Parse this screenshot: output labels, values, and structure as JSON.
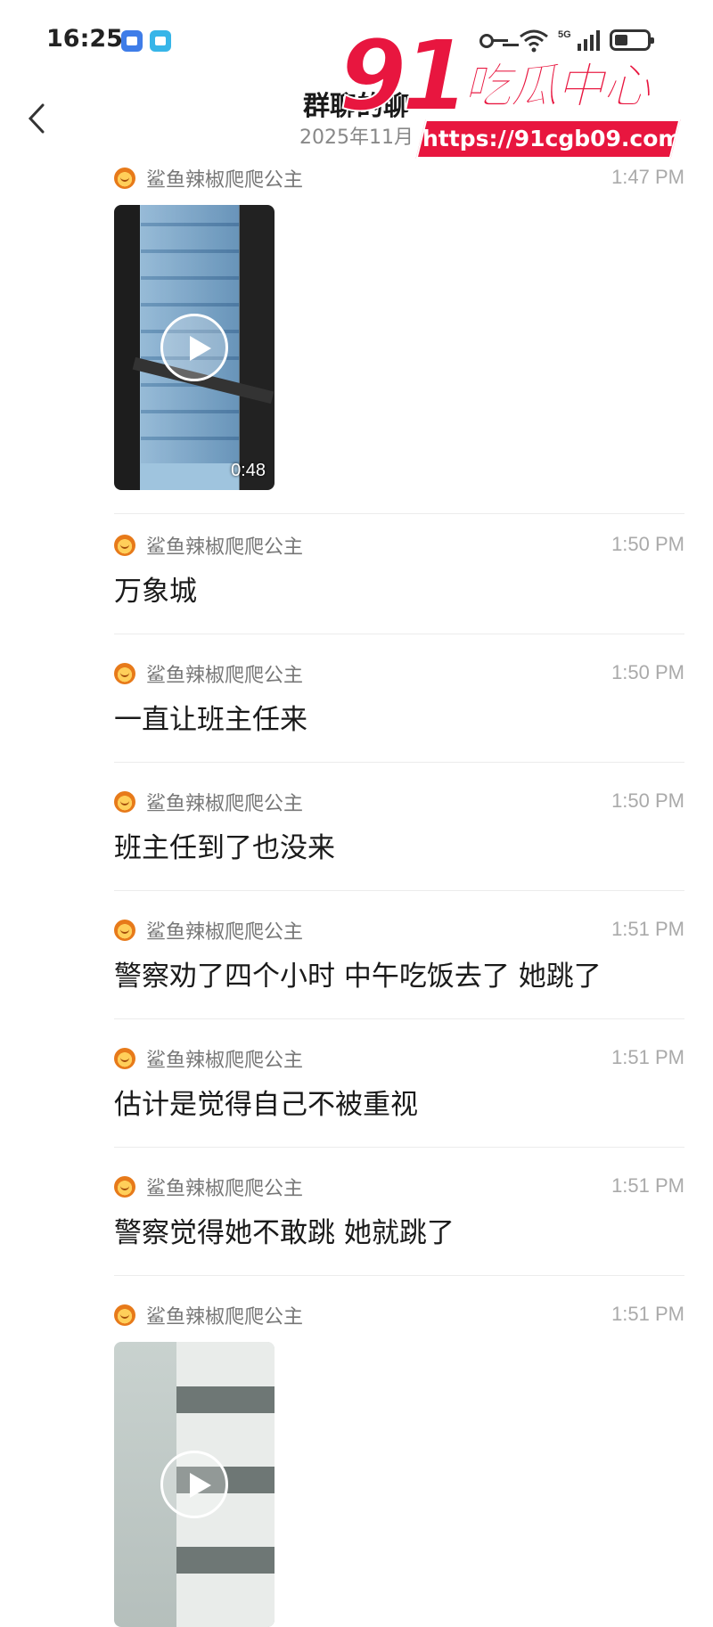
{
  "status_bar": {
    "time": "16:25"
  },
  "header": {
    "title": "群聊的聊",
    "subtitle": "2025年11月"
  },
  "watermark": {
    "number": "91",
    "text": "吃瓜中心",
    "url": "https://91cgb09.com"
  },
  "messages": [
    {
      "sender": "鲨鱼辣椒爬爬公主",
      "time": "1:47 PM",
      "type": "video",
      "duration": "0:48"
    },
    {
      "sender": "鲨鱼辣椒爬爬公主",
      "time": "1:50 PM",
      "type": "text",
      "text": "万象城"
    },
    {
      "sender": "鲨鱼辣椒爬爬公主",
      "time": "1:50 PM",
      "type": "text",
      "text": "一直让班主任来"
    },
    {
      "sender": "鲨鱼辣椒爬爬公主",
      "time": "1:50 PM",
      "type": "text",
      "text": "班主任到了也没来"
    },
    {
      "sender": "鲨鱼辣椒爬爬公主",
      "time": "1:51 PM",
      "type": "text",
      "text": "警察劝了四个小时 中午吃饭去了 她跳了"
    },
    {
      "sender": "鲨鱼辣椒爬爬公主",
      "time": "1:51 PM",
      "type": "text",
      "text": "估计是觉得自己不被重视"
    },
    {
      "sender": "鲨鱼辣椒爬爬公主",
      "time": "1:51 PM",
      "type": "text",
      "text": "警察觉得她不敢跳 她就跳了"
    },
    {
      "sender": "鲨鱼辣椒爬爬公主",
      "time": "1:51 PM",
      "type": "video"
    }
  ]
}
